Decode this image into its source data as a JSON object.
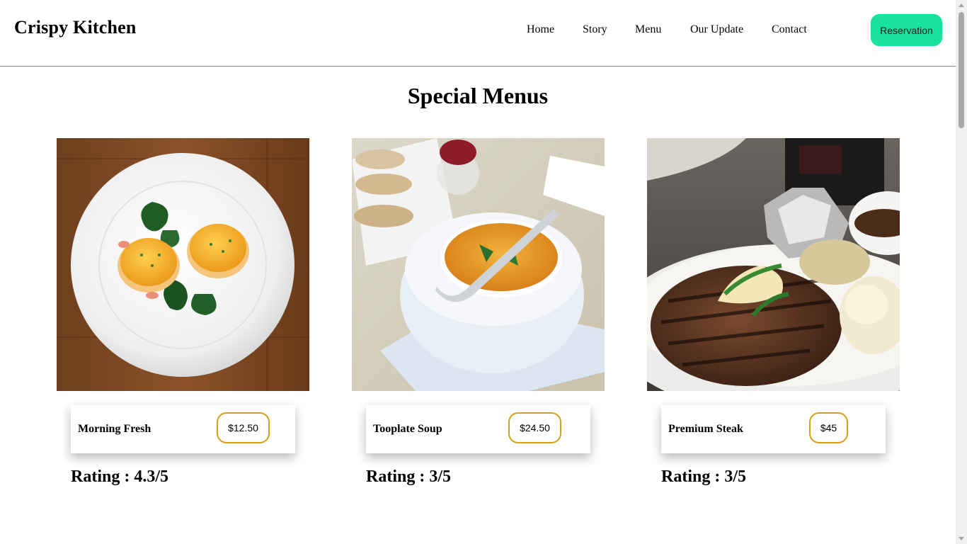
{
  "brand": "Crispy Kitchen",
  "nav": [
    "Home",
    "Story",
    "Menu",
    "Our Update",
    "Contact"
  ],
  "reservation_label": "Reservation",
  "section_title": "Special Menus",
  "accent_color": "#18e29c",
  "price_border_color": "#d4a017",
  "menus": [
    {
      "name": "Morning Fresh",
      "price": "$12.50",
      "rating_label": "Rating : 4.3/5",
      "image": "eggs-benedict-plate-photo"
    },
    {
      "name": "Tooplate Soup",
      "price": "$24.50",
      "rating_label": "Rating : 3/5",
      "image": "soup-bowl-photo"
    },
    {
      "name": "Premium Steak",
      "price": "$45",
      "rating_label": "Rating : 3/5",
      "image": "steak-dinner-photo"
    }
  ]
}
